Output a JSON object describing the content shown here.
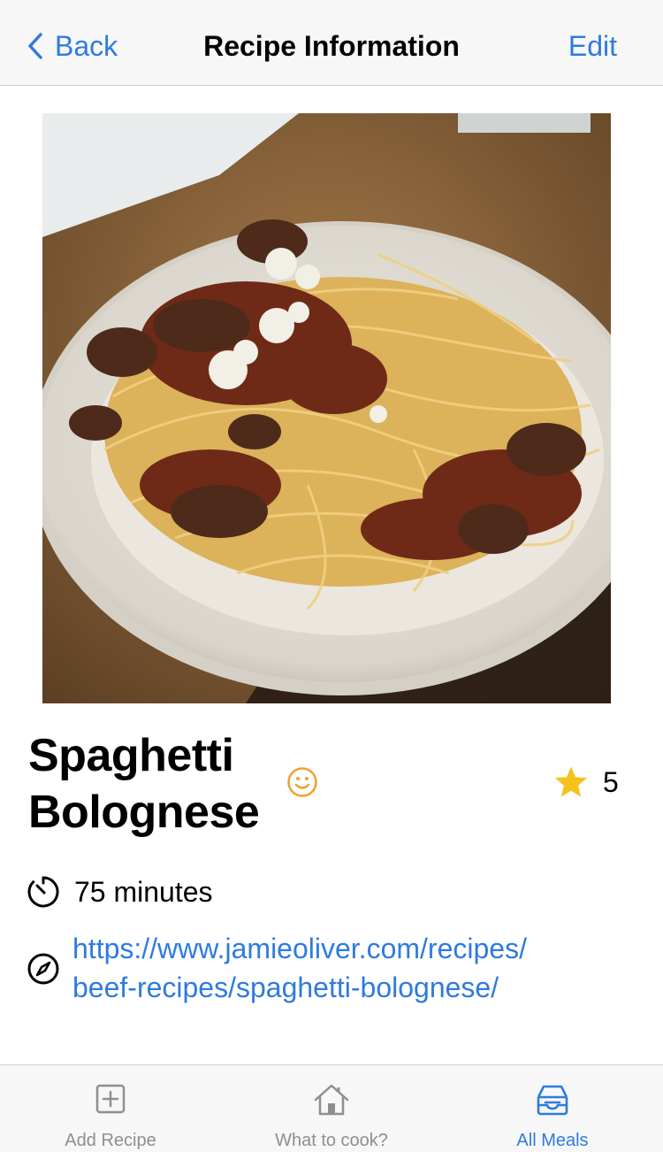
{
  "navbar": {
    "back_label": "Back",
    "title": "Recipe Information",
    "edit_label": "Edit"
  },
  "recipe": {
    "name": "Spaghetti Bolognese",
    "mood_icon": "smiley-face-icon",
    "rating": "5",
    "duration": "75 minutes",
    "url_line1": "https://www.jamieoliver.com/recipes/",
    "url_line2": "beef-recipes/spaghetti-bolognese/"
  },
  "tabbar": {
    "tabs": [
      {
        "label": "Add Recipe",
        "icon": "plus-square-icon",
        "active": false
      },
      {
        "label": "What to cook?",
        "icon": "house-icon",
        "active": false
      },
      {
        "label": "All Meals",
        "icon": "tray-icon",
        "active": true
      }
    ]
  },
  "colors": {
    "accent": "#2f7bde",
    "star": "#f5c21b",
    "smiley": "#f0a030",
    "inactive_tab": "#8e8e93"
  }
}
